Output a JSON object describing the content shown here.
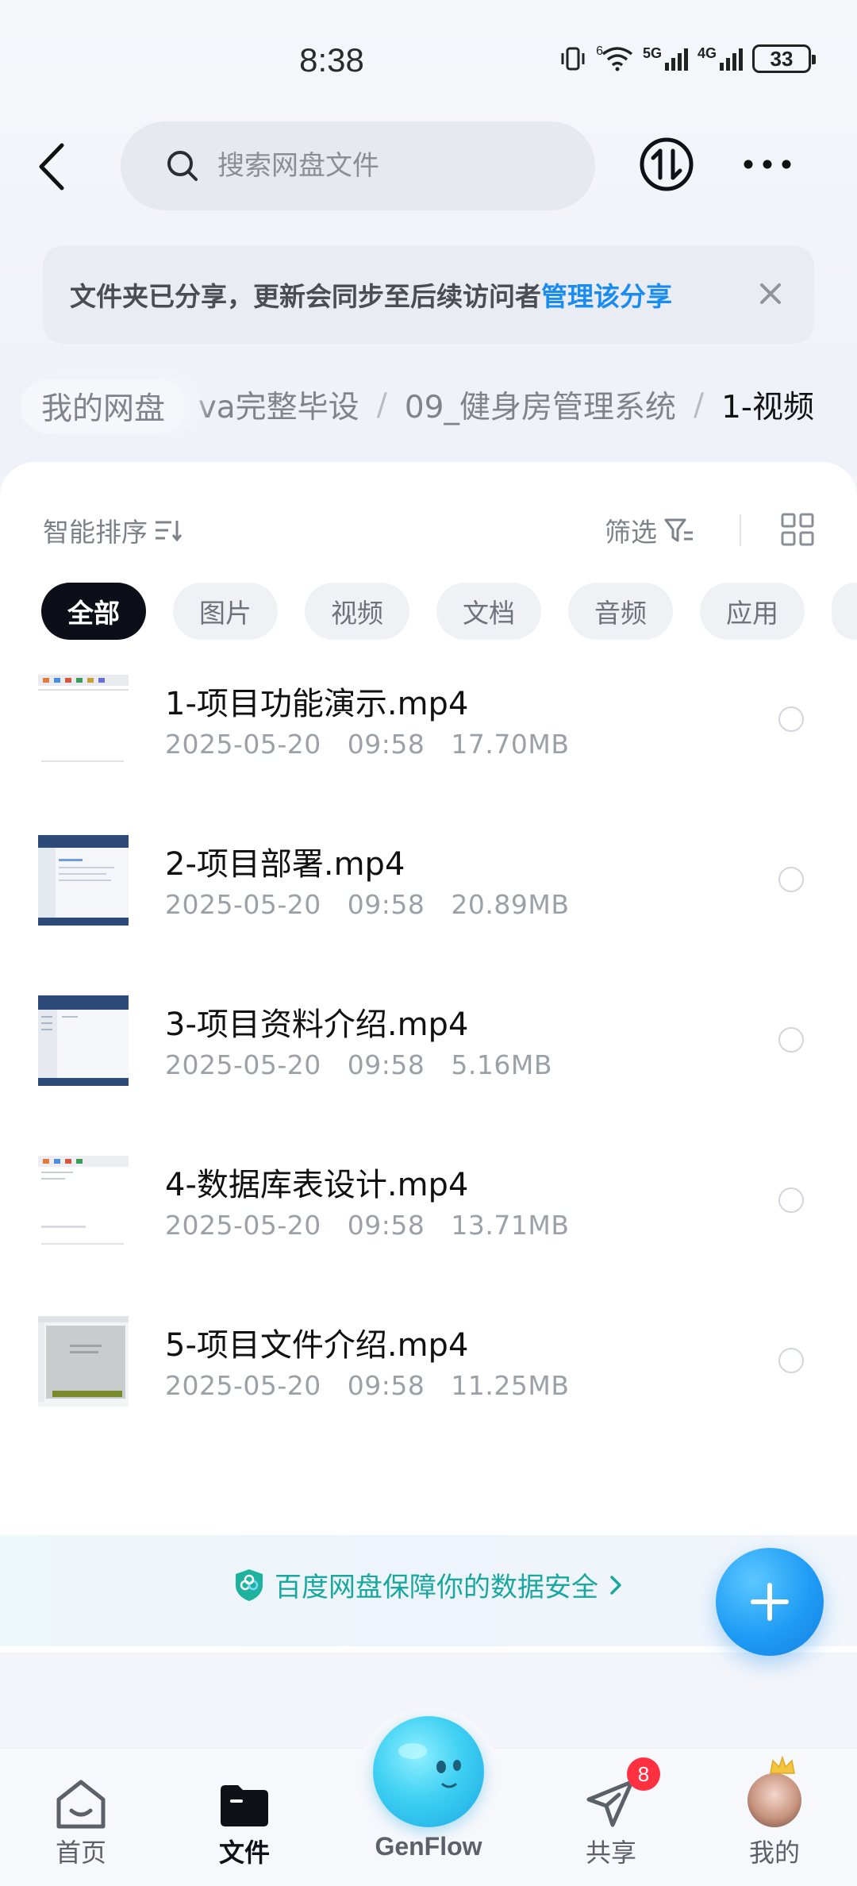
{
  "status_bar": {
    "time": "8:38",
    "net_5g_wifi": "6",
    "net_5g": "5G",
    "net_4g": "4G",
    "battery": "33"
  },
  "header": {
    "search_placeholder": "搜索网盘文件",
    "back_icon": "back-arrow-icon",
    "sync_icon": "transfer-icon",
    "more_icon": "more-icon"
  },
  "notice": {
    "text": "文件夹已分享，更新会同步至后续访问者",
    "link": "管理该分享"
  },
  "breadcrumb": {
    "home": "我的网盘",
    "items": [
      "va完整毕设",
      "09_健身房管理系统",
      "1-视频"
    ],
    "separator": "/"
  },
  "toolbar": {
    "sort_label": "智能排序",
    "filter_label": "筛选"
  },
  "chips": [
    "全部",
    "图片",
    "视频",
    "文档",
    "音频",
    "应用"
  ],
  "files": [
    {
      "name": "1-项目功能演示.mp4",
      "date": "2025-05-20",
      "time": "09:58",
      "size": "17.70MB"
    },
    {
      "name": "2-项目部署.mp4",
      "date": "2025-05-20",
      "time": "09:58",
      "size": "20.89MB"
    },
    {
      "name": "3-项目资料介绍.mp4",
      "date": "2025-05-20",
      "time": "09:58",
      "size": "5.16MB"
    },
    {
      "name": "4-数据库表设计.mp4",
      "date": "2025-05-20",
      "time": "09:58",
      "size": "13.71MB"
    },
    {
      "name": "5-项目文件介绍.mp4",
      "date": "2025-05-20",
      "time": "09:58",
      "size": "11.25MB"
    }
  ],
  "security_banner": {
    "text": "百度网盘保障你的数据安全"
  },
  "bottom_nav": {
    "home": "首页",
    "files": "文件",
    "genflow": "GenFlow",
    "share": "共享",
    "share_badge": "8",
    "mine": "我的"
  },
  "colors": {
    "accent": "#1a8cf0",
    "security": "#1aa7a0",
    "badge": "#ff3040",
    "chip_active": "#0c0f17"
  }
}
